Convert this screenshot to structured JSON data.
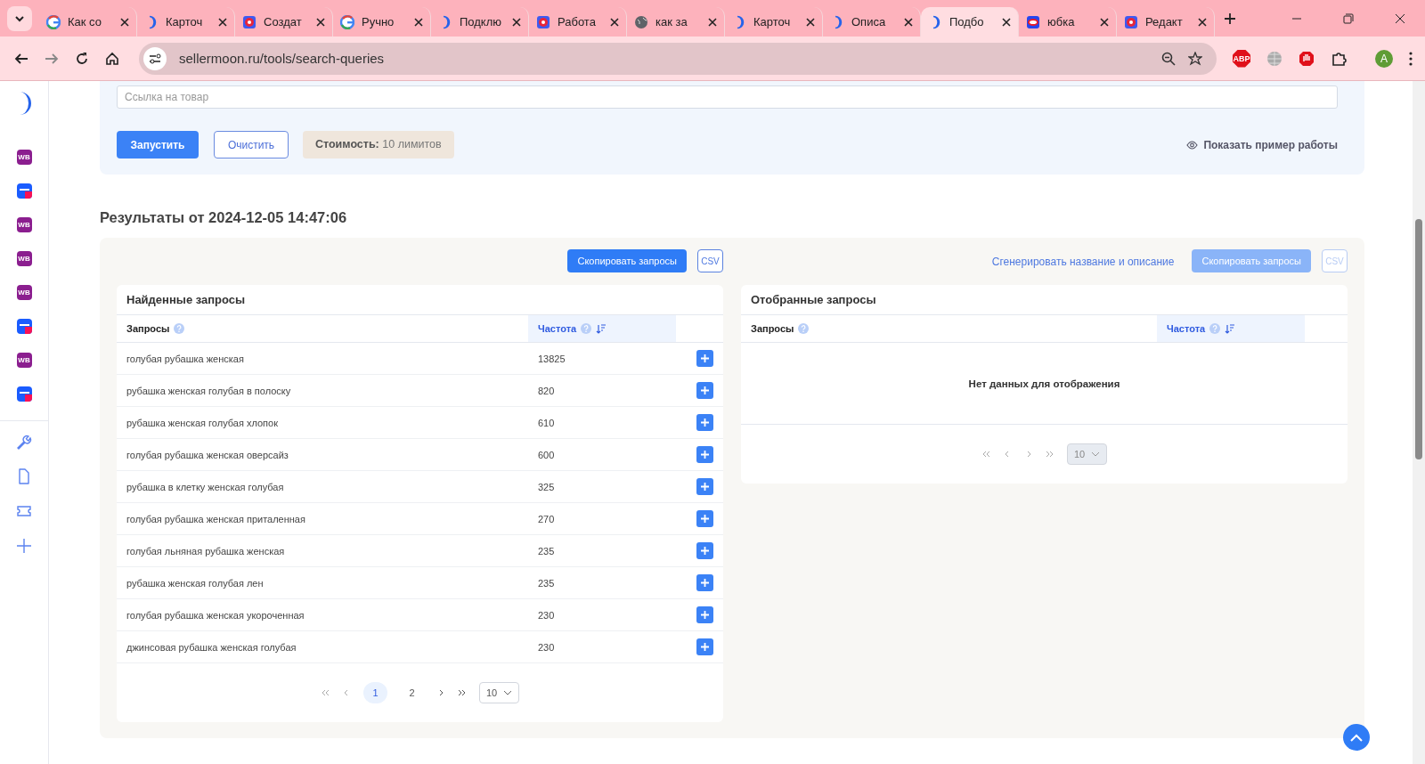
{
  "browser": {
    "tabs": [
      {
        "title": "Как со",
        "kind": "google",
        "selected": false
      },
      {
        "title": "Карточ",
        "kind": "moon",
        "selected": false
      },
      {
        "title": "Создат",
        "kind": "redq",
        "selected": false
      },
      {
        "title": "Ручно",
        "kind": "google",
        "selected": false
      },
      {
        "title": "Подклю",
        "kind": "moon",
        "selected": false
      },
      {
        "title": "Работа",
        "kind": "redq",
        "selected": false
      },
      {
        "title": "как за",
        "kind": "globe",
        "selected": false
      },
      {
        "title": "Карточ",
        "kind": "moon",
        "selected": false
      },
      {
        "title": "Описа",
        "kind": "moon",
        "selected": false
      },
      {
        "title": "Подбо",
        "kind": "moon",
        "selected": true
      },
      {
        "title": "юбка",
        "kind": "pill",
        "selected": false
      },
      {
        "title": "Редакт",
        "kind": "redq",
        "selected": false
      }
    ],
    "address": "sellermoon.ru/tools/search-queries",
    "adblock_label": "ABP",
    "profile": "A"
  },
  "sidebar": {
    "marketplaces": [
      {
        "kind": "wb",
        "label": "WB"
      },
      {
        "kind": "ozon"
      },
      {
        "kind": "wb",
        "label": "WB"
      },
      {
        "kind": "wb",
        "label": "WB"
      },
      {
        "kind": "wb",
        "label": "WB"
      },
      {
        "kind": "ozon"
      },
      {
        "kind": "wb",
        "label": "WB"
      },
      {
        "kind": "ozon"
      }
    ]
  },
  "form": {
    "link_field": {
      "placeholder": "Ссылка на товар"
    },
    "run_button": "Запустить",
    "clear_button": "Очистить",
    "cost": "**Стоимость:** 10 лимитов",
    "example_link": "Показать пример работы"
  },
  "results": {
    "heading": "Результаты от 2024-12-05 14:47:06",
    "left_toolbar": {
      "copy_button": {
        "label": "Скопировать запросы",
        "disabled": false
      },
      "csv_button": {
        "label": "CSV",
        "disabled": false
      }
    },
    "right_toolbar": {
      "generate_link": "Сгенерировать название и описание",
      "copy_button": {
        "label": "Скопировать запросы",
        "disabled": true
      },
      "csv_button": {
        "label": "CSV",
        "disabled": true
      }
    },
    "found": {
      "title": "Найденные запросы",
      "columns": [
        {
          "label": "Запросы",
          "sorted": false
        },
        {
          "label": "Частота",
          "sorted": true
        }
      ],
      "rows": [
        {
          "query": "голубая рубашка женская",
          "frequency": "13825"
        },
        {
          "query": "рубашка женская голубая в полоску",
          "frequency": "820"
        },
        {
          "query": "рубашка женская голубая хлопок",
          "frequency": "610"
        },
        {
          "query": "голубая рубашка женская оверсайз",
          "frequency": "600"
        },
        {
          "query": "рубашка в клетку женская голубая",
          "frequency": "325"
        },
        {
          "query": "голубая рубашка женская приталенная",
          "frequency": "270"
        },
        {
          "query": "голубая льняная рубашка женская",
          "frequency": "235"
        },
        {
          "query": "рубашка женская голубая лен",
          "frequency": "235"
        },
        {
          "query": "голубая рубашка женская укороченная",
          "frequency": "230"
        },
        {
          "query": "джинсовая рубашка женская голубая",
          "frequency": "230"
        }
      ],
      "pagination": {
        "pages": [
          {
            "label": "1",
            "selected": true
          },
          {
            "label": "2",
            "selected": false
          }
        ],
        "per_page": "10"
      }
    },
    "selected": {
      "title": "Отобранные запросы",
      "columns": [
        {
          "label": "Запросы",
          "sorted": false
        },
        {
          "label": "Частота",
          "sorted": true
        }
      ],
      "empty_message": "Нет данных для отображения",
      "pagination": {
        "per_page": "10"
      }
    }
  }
}
